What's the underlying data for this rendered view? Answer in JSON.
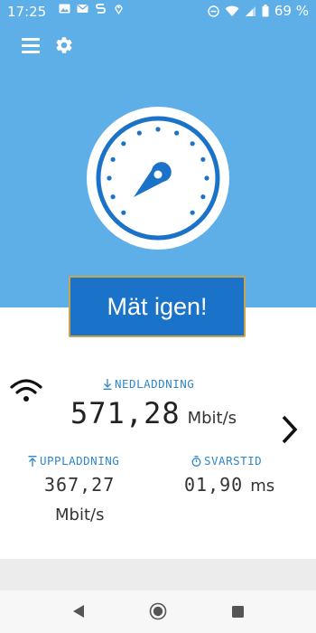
{
  "status_bar": {
    "time": "17:25",
    "battery": "69 %",
    "left_icons": [
      "image-icon",
      "mail-icon",
      "s-icon",
      "location-icon"
    ],
    "right_icons": [
      "dnd-icon",
      "wifi-icon",
      "signal-icon",
      "battery-icon"
    ]
  },
  "toolbar": {
    "menu_icon": "menu-icon",
    "settings_icon": "settings-icon"
  },
  "gauge": {
    "icon": "speedometer-gauge-icon"
  },
  "actions": {
    "measure_again": "Mät igen!"
  },
  "results": {
    "connection_icon": "wifi-icon",
    "download": {
      "label": "NEDLADDNING",
      "value": "571,28",
      "unit": "Mbit/s",
      "icon": "download-arrow-icon"
    },
    "upload": {
      "label": "UPPLADDNING",
      "value": "367,27",
      "unit": "Mbit/s",
      "icon": "upload-arrow-icon"
    },
    "ping": {
      "label": "SVARSTID",
      "value": "01,90",
      "unit": "ms",
      "icon": "stopwatch-icon"
    },
    "next_icon": "chevron-right-icon"
  },
  "colors": {
    "hero_background": "#5eaee8",
    "button_background": "#1a73c8",
    "button_border": "#c9a44a",
    "accent_label": "#2f86c9",
    "gauge_blue": "#1a73c8"
  },
  "navigation": {
    "back_icon": "back-triangle-icon",
    "home_icon": "home-circle-icon",
    "recents_icon": "recents-square-icon"
  }
}
